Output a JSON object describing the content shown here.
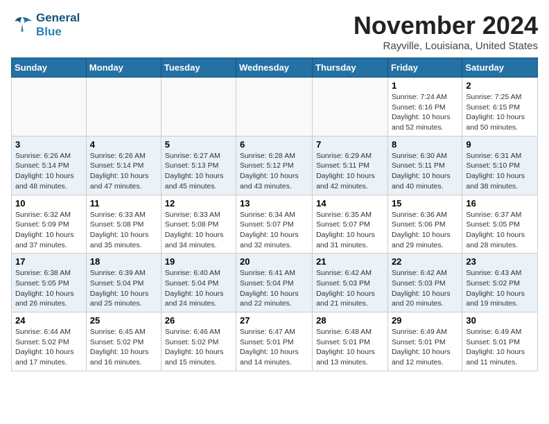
{
  "header": {
    "logo_line1": "General",
    "logo_line2": "Blue",
    "month": "November 2024",
    "location": "Rayville, Louisiana, United States"
  },
  "weekdays": [
    "Sunday",
    "Monday",
    "Tuesday",
    "Wednesday",
    "Thursday",
    "Friday",
    "Saturday"
  ],
  "weeks": [
    [
      {
        "day": "",
        "info": ""
      },
      {
        "day": "",
        "info": ""
      },
      {
        "day": "",
        "info": ""
      },
      {
        "day": "",
        "info": ""
      },
      {
        "day": "",
        "info": ""
      },
      {
        "day": "1",
        "info": "Sunrise: 7:24 AM\nSunset: 6:16 PM\nDaylight: 10 hours\nand 52 minutes."
      },
      {
        "day": "2",
        "info": "Sunrise: 7:25 AM\nSunset: 6:15 PM\nDaylight: 10 hours\nand 50 minutes."
      }
    ],
    [
      {
        "day": "3",
        "info": "Sunrise: 6:26 AM\nSunset: 5:14 PM\nDaylight: 10 hours\nand 48 minutes."
      },
      {
        "day": "4",
        "info": "Sunrise: 6:26 AM\nSunset: 5:14 PM\nDaylight: 10 hours\nand 47 minutes."
      },
      {
        "day": "5",
        "info": "Sunrise: 6:27 AM\nSunset: 5:13 PM\nDaylight: 10 hours\nand 45 minutes."
      },
      {
        "day": "6",
        "info": "Sunrise: 6:28 AM\nSunset: 5:12 PM\nDaylight: 10 hours\nand 43 minutes."
      },
      {
        "day": "7",
        "info": "Sunrise: 6:29 AM\nSunset: 5:11 PM\nDaylight: 10 hours\nand 42 minutes."
      },
      {
        "day": "8",
        "info": "Sunrise: 6:30 AM\nSunset: 5:11 PM\nDaylight: 10 hours\nand 40 minutes."
      },
      {
        "day": "9",
        "info": "Sunrise: 6:31 AM\nSunset: 5:10 PM\nDaylight: 10 hours\nand 38 minutes."
      }
    ],
    [
      {
        "day": "10",
        "info": "Sunrise: 6:32 AM\nSunset: 5:09 PM\nDaylight: 10 hours\nand 37 minutes."
      },
      {
        "day": "11",
        "info": "Sunrise: 6:33 AM\nSunset: 5:08 PM\nDaylight: 10 hours\nand 35 minutes."
      },
      {
        "day": "12",
        "info": "Sunrise: 6:33 AM\nSunset: 5:08 PM\nDaylight: 10 hours\nand 34 minutes."
      },
      {
        "day": "13",
        "info": "Sunrise: 6:34 AM\nSunset: 5:07 PM\nDaylight: 10 hours\nand 32 minutes."
      },
      {
        "day": "14",
        "info": "Sunrise: 6:35 AM\nSunset: 5:07 PM\nDaylight: 10 hours\nand 31 minutes."
      },
      {
        "day": "15",
        "info": "Sunrise: 6:36 AM\nSunset: 5:06 PM\nDaylight: 10 hours\nand 29 minutes."
      },
      {
        "day": "16",
        "info": "Sunrise: 6:37 AM\nSunset: 5:05 PM\nDaylight: 10 hours\nand 28 minutes."
      }
    ],
    [
      {
        "day": "17",
        "info": "Sunrise: 6:38 AM\nSunset: 5:05 PM\nDaylight: 10 hours\nand 26 minutes."
      },
      {
        "day": "18",
        "info": "Sunrise: 6:39 AM\nSunset: 5:04 PM\nDaylight: 10 hours\nand 25 minutes."
      },
      {
        "day": "19",
        "info": "Sunrise: 6:40 AM\nSunset: 5:04 PM\nDaylight: 10 hours\nand 24 minutes."
      },
      {
        "day": "20",
        "info": "Sunrise: 6:41 AM\nSunset: 5:04 PM\nDaylight: 10 hours\nand 22 minutes."
      },
      {
        "day": "21",
        "info": "Sunrise: 6:42 AM\nSunset: 5:03 PM\nDaylight: 10 hours\nand 21 minutes."
      },
      {
        "day": "22",
        "info": "Sunrise: 6:42 AM\nSunset: 5:03 PM\nDaylight: 10 hours\nand 20 minutes."
      },
      {
        "day": "23",
        "info": "Sunrise: 6:43 AM\nSunset: 5:02 PM\nDaylight: 10 hours\nand 19 minutes."
      }
    ],
    [
      {
        "day": "24",
        "info": "Sunrise: 6:44 AM\nSunset: 5:02 PM\nDaylight: 10 hours\nand 17 minutes."
      },
      {
        "day": "25",
        "info": "Sunrise: 6:45 AM\nSunset: 5:02 PM\nDaylight: 10 hours\nand 16 minutes."
      },
      {
        "day": "26",
        "info": "Sunrise: 6:46 AM\nSunset: 5:02 PM\nDaylight: 10 hours\nand 15 minutes."
      },
      {
        "day": "27",
        "info": "Sunrise: 6:47 AM\nSunset: 5:01 PM\nDaylight: 10 hours\nand 14 minutes."
      },
      {
        "day": "28",
        "info": "Sunrise: 6:48 AM\nSunset: 5:01 PM\nDaylight: 10 hours\nand 13 minutes."
      },
      {
        "day": "29",
        "info": "Sunrise: 6:49 AM\nSunset: 5:01 PM\nDaylight: 10 hours\nand 12 minutes."
      },
      {
        "day": "30",
        "info": "Sunrise: 6:49 AM\nSunset: 5:01 PM\nDaylight: 10 hours\nand 11 minutes."
      }
    ]
  ]
}
